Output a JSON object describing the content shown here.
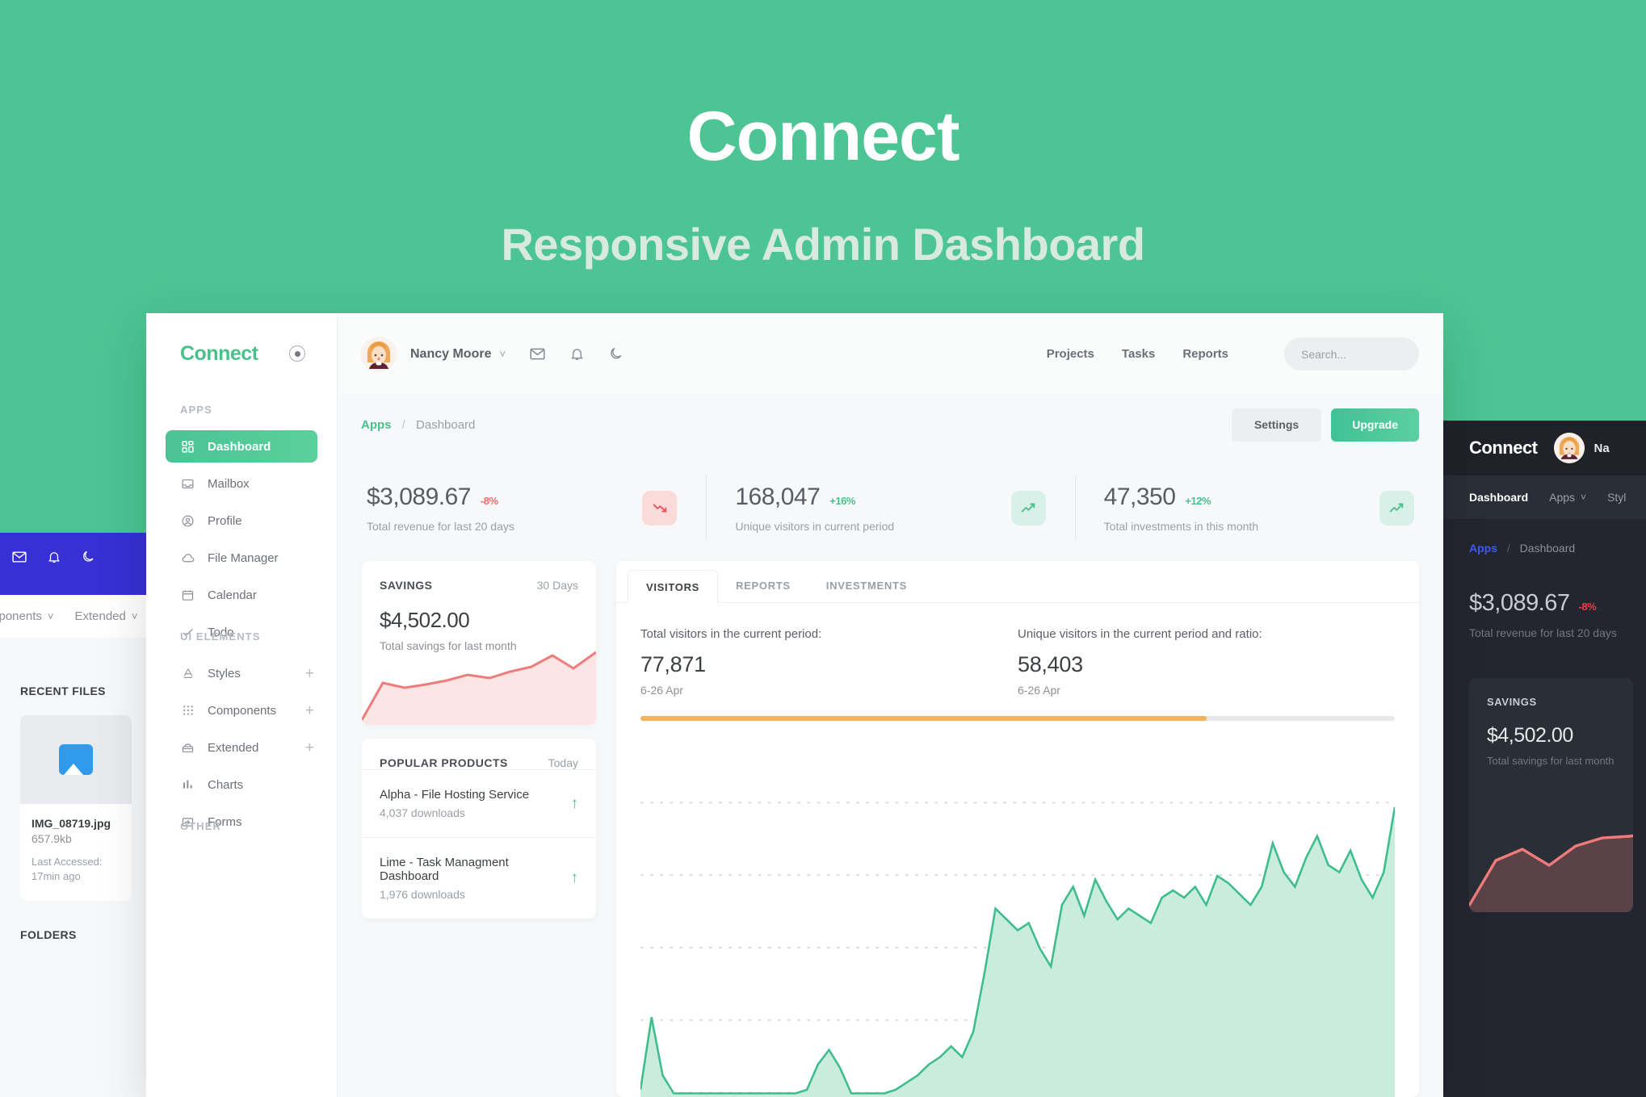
{
  "hero": {
    "title": "Connect",
    "subtitle": "Responsive Admin Dashboard"
  },
  "colors": {
    "brand_green": "#4ac08c",
    "hero_bg": "#4cc493",
    "danger_red": "#ef6b6b",
    "accent_orange": "#f2b35c",
    "peek_blue": "#3730d4",
    "dark_bg": "#23262e"
  },
  "sidebar": {
    "brand": "Connect",
    "brand_icon": "target-dot-icon",
    "sections": [
      {
        "heading": "APPS",
        "items": [
          {
            "label": "Dashboard",
            "icon": "grid-icon",
            "active": true,
            "expandable": false
          },
          {
            "label": "Mailbox",
            "icon": "inbox-icon",
            "active": false,
            "expandable": false
          },
          {
            "label": "Profile",
            "icon": "user-circle-icon",
            "active": false,
            "expandable": false
          },
          {
            "label": "File Manager",
            "icon": "cloud-icon",
            "active": false,
            "expandable": false
          },
          {
            "label": "Calendar",
            "icon": "calendar-icon",
            "active": false,
            "expandable": false
          },
          {
            "label": "Todo",
            "icon": "check-icon",
            "active": false,
            "expandable": false
          }
        ]
      },
      {
        "heading": "UI ELEMENTS",
        "items": [
          {
            "label": "Styles",
            "icon": "typography-icon",
            "active": false,
            "expandable": true,
            "expand_glyph": "+"
          },
          {
            "label": "Components",
            "icon": "dots-grid-icon",
            "active": false,
            "expandable": true,
            "expand_glyph": "+"
          },
          {
            "label": "Extended",
            "icon": "box-icon",
            "active": false,
            "expandable": true,
            "expand_glyph": "+"
          },
          {
            "label": "Charts",
            "icon": "bar-chart-icon",
            "active": false,
            "expandable": false
          },
          {
            "label": "Forms",
            "icon": "form-input-icon",
            "active": false,
            "expandable": false
          }
        ]
      },
      {
        "heading": "OTHER",
        "items": []
      }
    ]
  },
  "topbar": {
    "avatar_alt": "avatar",
    "user_name": "Nancy Moore",
    "user_chevron": "˅",
    "icons": [
      "mail-icon",
      "bell-icon",
      "moon-icon"
    ],
    "links": [
      "Projects",
      "Tasks",
      "Reports"
    ],
    "search_placeholder": "Search..."
  },
  "breadcrumb": {
    "root": "Apps",
    "separator": "/",
    "current": "Dashboard",
    "settings_label": "Settings",
    "upgrade_label": "Upgrade"
  },
  "kpis": [
    {
      "value": "$3,089.67",
      "delta": "-8%",
      "direction": "down",
      "caption": "Total revenue for last 20 days",
      "badge_icon": "trend-down-icon"
    },
    {
      "value": "168,047",
      "delta": "+16%",
      "direction": "up",
      "caption": "Unique visitors in current period",
      "badge_icon": "trend-up-icon"
    },
    {
      "value": "47,350",
      "delta": "+12%",
      "direction": "up",
      "caption": "Total investments in this month",
      "badge_icon": "trend-up-icon"
    }
  ],
  "savings_card": {
    "title": "SAVINGS",
    "meta": "30 Days",
    "value": "$4,502.00",
    "caption": "Total savings for last month"
  },
  "products_card": {
    "title": "POPULAR PRODUCTS",
    "meta": "Today",
    "rows": [
      {
        "name": "Alpha - File Hosting Service",
        "sub": "4,037 downloads",
        "arrow": "↑"
      },
      {
        "name": "Lime - Task Managment Dashboard",
        "sub": "1,976 downloads",
        "arrow": "↑"
      }
    ]
  },
  "visitors_card": {
    "tabs": [
      {
        "label": "VISITORS",
        "active": true
      },
      {
        "label": "REPORTS",
        "active": false
      },
      {
        "label": "INVESTMENTS",
        "active": false
      }
    ],
    "stats": [
      {
        "label": "Total visitors in the current period:",
        "value": "77,871",
        "date": "6-26 Apr"
      },
      {
        "label": "Unique visitors in the current period and ratio:",
        "value": "58,403",
        "date": "6-26 Apr"
      }
    ],
    "progress_percent": 75
  },
  "peek_left": {
    "nav_items": [
      "mponents",
      "Extended"
    ],
    "nav_chevron": "˅",
    "icons": [
      "chevron-down-icon",
      "mail-icon",
      "bell-icon",
      "moon-icon"
    ],
    "recent_files_heading": "RECENT FILES",
    "file": {
      "name": "IMG_08719.jpg",
      "size": "657.9kb",
      "accessed": "Last Accessed: 17min ago"
    },
    "folders_heading": "FOLDERS"
  },
  "peek_right": {
    "brand": "Connect",
    "user_name": "Na",
    "nav": [
      {
        "label": "Dashboard",
        "active": true,
        "chevron": false
      },
      {
        "label": "Apps",
        "active": false,
        "chevron": true
      },
      {
        "label": "Styl",
        "active": false,
        "chevron": false
      }
    ],
    "chevron_glyph": "˅",
    "breadcrumb": {
      "root": "Apps",
      "separator": "/",
      "current": "Dashboard"
    },
    "kpi": {
      "value": "$3,089.67",
      "delta": "-8%",
      "caption": "Total revenue for last 20 days"
    },
    "savings": {
      "title": "SAVINGS",
      "value": "$4,502.00",
      "caption": "Total savings for last month"
    }
  },
  "chart_data": [
    {
      "type": "area",
      "name": "visitors-area-chart",
      "title": "Visitors",
      "xlabel": "",
      "ylabel": "",
      "grid": true,
      "gridlines": 5,
      "line_color": "#3fbd8f",
      "fill_color": "#c9ecdf",
      "ylim": [
        0,
        100
      ],
      "values": [
        2,
        22,
        6,
        1,
        1,
        1,
        1,
        1,
        1,
        1,
        1,
        1,
        1,
        1,
        1,
        2,
        9,
        13,
        8,
        1,
        1,
        1,
        1,
        2,
        4,
        6,
        9,
        11,
        14,
        11,
        18,
        34,
        52,
        49,
        46,
        48,
        41,
        36,
        53,
        58,
        50,
        60,
        54,
        49,
        52,
        50,
        48,
        55,
        57,
        55,
        58,
        53,
        61,
        59,
        56,
        53,
        58,
        70,
        62,
        58,
        66,
        72,
        64,
        62,
        68,
        60,
        55,
        62,
        80
      ]
    },
    {
      "type": "area",
      "name": "savings-sparkline-light",
      "title": "Savings",
      "grid": false,
      "line_color": "#ef7b7b",
      "fill_color": "#fde5e5",
      "ylim": [
        0,
        100
      ],
      "values": [
        5,
        42,
        36,
        40,
        45,
        52,
        48,
        56,
        62,
        80,
        62,
        86
      ]
    },
    {
      "type": "area",
      "name": "savings-sparkline-dark",
      "title": "Savings",
      "grid": false,
      "line_color": "#ef7b7b",
      "fill_color": "#5b4247",
      "ylim": [
        0,
        100
      ],
      "values": [
        4,
        48,
        56,
        72,
        62,
        78,
        80,
        82
      ]
    }
  ]
}
